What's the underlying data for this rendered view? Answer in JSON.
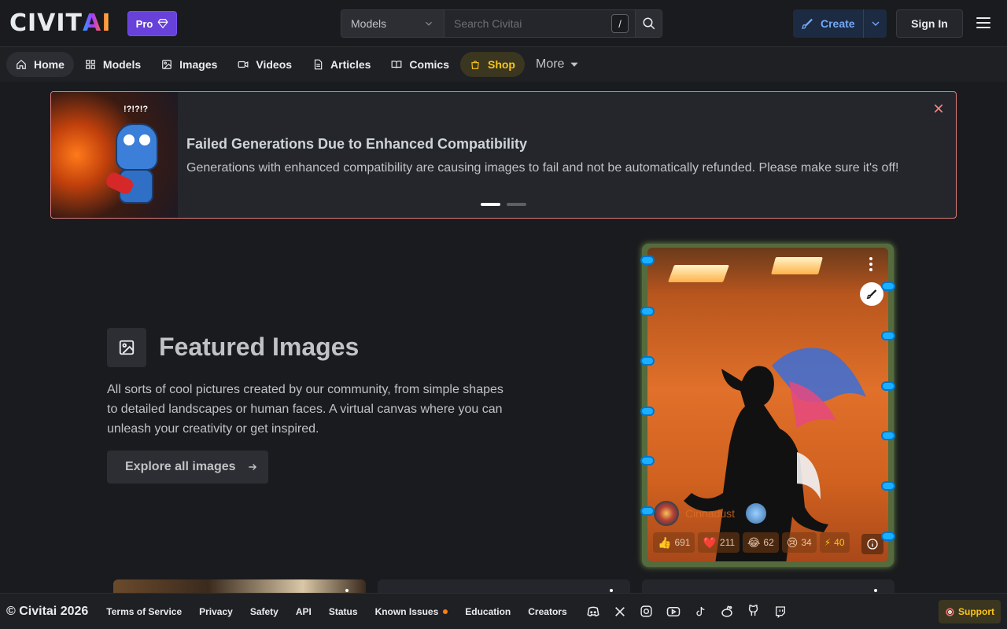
{
  "header": {
    "logo_left": "CIVIT",
    "logo_right": "AI",
    "pro_label": "Pro",
    "search_scope": "Models",
    "search_placeholder": "Search Civitai",
    "search_shortcut": "/",
    "create_label": "Create",
    "signin_label": "Sign In"
  },
  "nav": {
    "items": [
      {
        "label": "Home",
        "icon": "home-icon"
      },
      {
        "label": "Models",
        "icon": "grid-icon"
      },
      {
        "label": "Images",
        "icon": "image-icon"
      },
      {
        "label": "Videos",
        "icon": "video-icon"
      },
      {
        "label": "Articles",
        "icon": "document-icon"
      },
      {
        "label": "Comics",
        "icon": "book-icon"
      },
      {
        "label": "Shop",
        "icon": "shopping-bag-icon"
      }
    ],
    "more_label": "More"
  },
  "banner": {
    "title": "Failed Generations Due to Enhanced Compatibility",
    "text": "Generations with enhanced compatibility are causing images to fail and not be automatically refunded. Please make sure it's off!",
    "bubble_text": "!?!?!?",
    "slides_total": 2,
    "slide_active": 1
  },
  "featured": {
    "title": "Featured Images",
    "description": "All sorts of cool pictures created by our community, from simple shapes to detailed landscapes or human faces. A virtual canvas where you can unleash your creativity or get inspired.",
    "button_label": "Explore all images"
  },
  "image_card": {
    "username": "Cinnadust",
    "reactions": {
      "like": "691",
      "heart": "211",
      "laugh": "62",
      "cry": "34",
      "buzz": "40"
    }
  },
  "footer": {
    "copyright": "© Civitai 2026",
    "links": [
      "Terms of Service",
      "Privacy",
      "Safety",
      "API",
      "Status",
      "Known Issues",
      "Education",
      "Creators"
    ],
    "social_icons": [
      "discord-icon",
      "x-icon",
      "instagram-icon",
      "youtube-icon",
      "tiktok-icon",
      "reddit-icon",
      "github-icon",
      "twitch-icon"
    ],
    "support_label": "Support"
  },
  "colors": {
    "background": "#1a1b1e",
    "pro": "#6741d9",
    "create_text": "#74a8f7",
    "shop": "#fcc419",
    "banner_border": "#e07a7a",
    "card_glow": "#556b3d"
  }
}
